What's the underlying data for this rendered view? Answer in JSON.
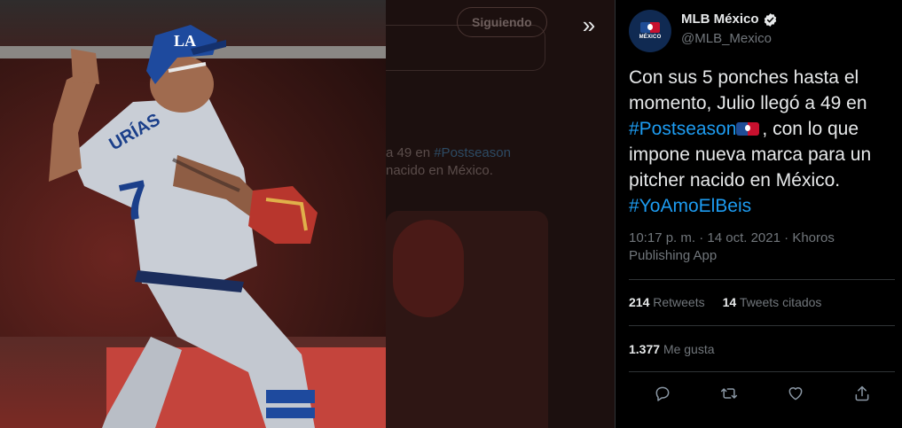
{
  "viewer": {
    "next_label": "»",
    "photo_alt": "Pitcher in grey uniform with number 7 throwing a pitch"
  },
  "background_tweet": {
    "follow_label": "Siguiendo",
    "snippet_line1_prefix": "a 49 en ",
    "snippet_line1_tag": "#Postseason",
    "snippet_line2": "nacido en México."
  },
  "tweet": {
    "display_name": "MLB México",
    "handle": "@MLB_Mexico",
    "avatar_label": "MÉXICO",
    "text_part1": "Con sus 5 ponches hasta el momento, Julio llegó a 49 en ",
    "hashtag1": "#Postseason",
    "text_part2": ", con lo que impone nueva marca para un pitcher nacido en México.",
    "hashtag2": "#YoAmoElBeis",
    "time": "10:17 p. m.",
    "separator": " · ",
    "date": "14 oct. 2021",
    "source": "Khoros Publishing App",
    "retweets_count": "214",
    "retweets_label": "Retweets",
    "quotes_count": "14",
    "quotes_label": "Tweets citados",
    "likes_count": "1.377",
    "likes_label": "Me gusta"
  },
  "icons": {
    "verified": "verified-badge-icon",
    "reply": "reply-icon",
    "retweet": "retweet-icon",
    "like": "heart-icon",
    "share": "share-icon",
    "next": "chevron-double-right-icon"
  },
  "colors": {
    "accent": "#1d9bf0",
    "text": "#e7e9ea",
    "muted": "#71767b",
    "divider": "#2f3336",
    "brand_blue": "#1f4d96",
    "brand_red": "#c8102e"
  }
}
